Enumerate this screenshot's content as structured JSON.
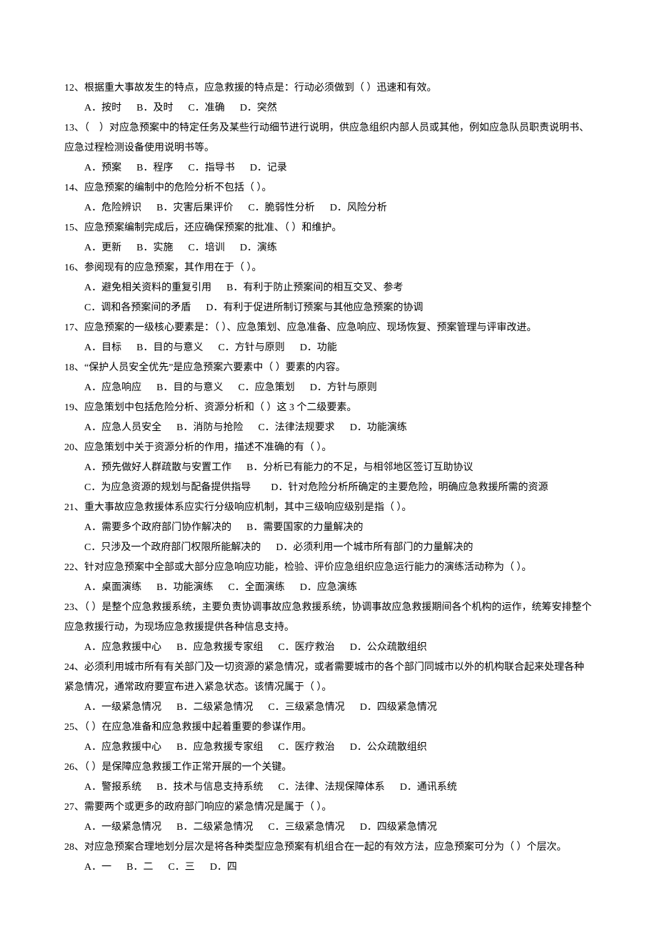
{
  "questions": [
    {
      "num": "12",
      "stem": "、根据重大事故发生的特点，应急救援的特点是：行动必须做到（ ）迅速和有效。",
      "option_lines": [
        [
          "A．按时",
          "B．及时",
          "C．准确",
          "D．突然"
        ]
      ]
    },
    {
      "num": "13",
      "stem": "、（　）对应急预案中的特定任务及某些行动细节进行说明，供应急组织内部人员或其他，例如应急队员职责说明书、应急过程检测设备使用说明书等。",
      "option_lines": [
        [
          "A．预案",
          "B．程序",
          "C．指导书",
          "D．记录"
        ]
      ]
    },
    {
      "num": "14",
      "stem": "、应急预案的编制中的危险分析不包括（ ）。",
      "option_lines": [
        [
          "A．危险辨识",
          "B．灾害后果评价",
          "C．脆弱性分析",
          "D．风险分析"
        ]
      ]
    },
    {
      "num": "15",
      "stem": "、应急预案编制完成后，还应确保预案的批准、（ ）和维护。",
      "option_lines": [
        [
          "A．更新",
          "B．实施",
          "C．培训",
          "D．演练"
        ]
      ]
    },
    {
      "num": "16",
      "stem": "、参阅现有的应急预案，其作用在于（ ）。",
      "option_lines": [
        [
          "A．避免相关资料的重复引用",
          "B．有利于防止预案间的相互交叉、参考"
        ],
        [
          "C．调和各预案间的矛盾",
          "D．有利于促进所制订预案与其他应急预案的协调"
        ]
      ]
    },
    {
      "num": "17",
      "stem": "、应急预案的一级核心要素是：（ ）、应急策划、应急准备、应急响应、现场恢复、预案管理与评审改进。",
      "option_lines": [
        [
          "A．目标",
          "B．目的与意义",
          "C．方针与原则",
          "D．功能"
        ]
      ]
    },
    {
      "num": "18",
      "stem": "、“保护人员安全优先”是应急预案六要素中（ ）要素的内容。",
      "option_lines": [
        [
          "A．应急响应",
          "B．目的与意义",
          "C．应急策划",
          "D．方针与原则"
        ]
      ]
    },
    {
      "num": "19",
      "stem": "、应急策划中包括危险分析、资源分析和（ ）这 3 个二级要素。",
      "option_lines": [
        [
          "A．应急人员安全",
          "B．消防与抢险",
          "C．法律法规要求",
          "D．功能演练"
        ]
      ]
    },
    {
      "num": "20",
      "stem": "、应急策划中关于资源分析的作用，描述不准确的有（ ）。",
      "option_lines": [
        [
          "A．预先做好人群疏散与安置工作",
          "B．分析已有能力的不足，与相邻地区签订互助协议"
        ]
      ],
      "wrap_option": "C．为应急资源的规划与配备提供指导　　D．针对危险分析所确定的主要危险，明确应急救援所需的资源"
    },
    {
      "num": "21",
      "stem": "、重大事故应急救援体系应实行分级响应机制，其中三级响应级别是指（ ）。",
      "option_lines": [
        [
          "A．需要多个政府部门协作解决的",
          "B．需要国家的力量解决的"
        ],
        [
          "C．只涉及一个政府部门权限所能解决的",
          "D．必须利用一个城市所有部门的力量解决的"
        ]
      ]
    },
    {
      "num": "22",
      "stem": "、针对应急预案中全部或大部分应急响应功能，检验、评价应急组织应急运行能力的演练活动称为（ ）。",
      "option_lines": [
        [
          "A．桌面演练",
          "B．功能演练",
          "C．全面演练",
          "D．应急演练"
        ]
      ]
    },
    {
      "num": "23",
      "stem": "、（ ）是整个应急救援系统，主要负责协调事故应急救援系统，协调事故应急救援期间各个机构的运作，统筹安排整个应急救援行动，为现场应急救援提供各种信息支持。",
      "option_lines": [
        [
          "A．应急救援中心",
          "B．应急救援专家组",
          "C．医疗救治",
          "D．公众疏散组织"
        ]
      ]
    },
    {
      "num": "24",
      "stem": "、必须利用城市所有有关部门及一切资源的紧急情况，或者需要城市的各个部门同城市以外的机构联合起来处理各种紧急情况，通常政府要宣布进入紧急状态。该情况属于（ ）。",
      "option_lines": [
        [
          "A．一级紧急情况",
          "B．二级紧急情况",
          "C．三级紧急情况",
          "D．四级紧急情况"
        ]
      ]
    },
    {
      "num": "25",
      "stem": "、（ ）在应急准备和应急救援中起着重要的参谋作用。",
      "option_lines": [
        [
          "A．应急救援中心",
          "B．应急救援专家组",
          "C．医疗救治",
          "D．公众疏散组织"
        ]
      ]
    },
    {
      "num": "26",
      "stem": "、（ ）是保障应急救援工作正常开展的一个关键。",
      "option_lines": [
        [
          "A．警报系统",
          "B．技术与信息支持系统",
          "C．法律、法规保障体系",
          "D．通讯系统"
        ]
      ]
    },
    {
      "num": "27",
      "stem": "、需要两个或更多的政府部门响应的紧急情况是属于（ ）。",
      "option_lines": [
        [
          "A．一级紧急情况",
          "B．二级紧急情况",
          "C．三级紧急情况",
          "D．四级紧急情况"
        ]
      ]
    },
    {
      "num": "28",
      "stem": "、对应急预案合理地划分层次是将各种类型应急预案有机组合在一起的有效方法，应急预案可分为（ ）个层次。",
      "option_lines": [
        [
          "A．一",
          "B．二",
          "C．三",
          "D．四"
        ]
      ]
    }
  ]
}
